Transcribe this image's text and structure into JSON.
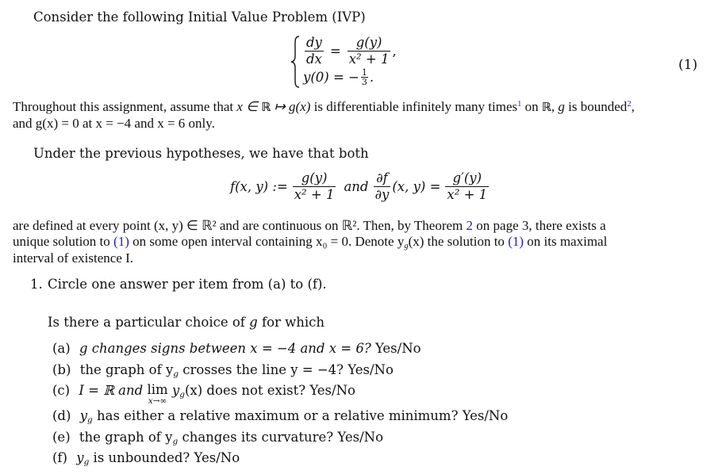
{
  "intro": "Consider the following Initial Value Problem (IVP)",
  "ivp": {
    "lhs_num": "dy",
    "lhs_den": "dx",
    "rhs_num": "g(y)",
    "rhs_den": "x² + 1",
    "trail": ",",
    "initial_lhs": "y(0) = −",
    "initial_frac_num": "1",
    "initial_frac_den": "3",
    "initial_trail": ".",
    "equation_number": "(1)"
  },
  "assumptions": {
    "line1_a": "Throughout this assignment, assume that ",
    "line1_math": "x ∈ ",
    "line1_R": "ℝ",
    "line1_map": " ↦ g(x)",
    "line1_b": " is differentiable infinitely many times",
    "footnote1": "1",
    "line1_c": " on ",
    "line1_R2": "ℝ",
    "line1_d": ", ",
    "line1_g": "g",
    "line1_e": " is bounded",
    "footnote2": "2",
    "line1_f": ",",
    "line2": "and g(x) = 0 at x = −4 and x = 6 only."
  },
  "hypotheses_intro": "Under the previous hypotheses, we have that both",
  "definitions": {
    "f_lhs": "f(x, y) :=",
    "f_num": "g(y)",
    "f_den": "x² + 1",
    "and": "and",
    "partial_num": "∂f",
    "partial_den": "∂y",
    "partial_args": "(x, y) =",
    "deriv_num": "g′(y)",
    "deriv_den": "x² + 1"
  },
  "existence": {
    "line1_a": "are defined at every point (x, y) ∈ ℝ² and are continuous on ℝ². Then, by Theorem ",
    "theorem_ref": "2",
    "line1_b": " on page 3, there exists a",
    "line2_a": "unique solution to ",
    "eq_ref1": "(1)",
    "line2_b": " on some open interval containing x₀ = 0. Denote y",
    "line2_sub": "g",
    "line2_c": "(x) the solution to ",
    "eq_ref2": "(1)",
    "line2_d": " on its maximal",
    "line3": "interval of existence I."
  },
  "question": {
    "number": "1.",
    "instruction": "Circle one answer per item from (a) to (f).",
    "prompt_a": "Is there a particular choice of ",
    "prompt_g": "g",
    "prompt_b": " for which",
    "items": [
      {
        "label": "(a)",
        "text": "g changes signs between x = −4 and x = 6? ",
        "answer": "Yes/No"
      },
      {
        "label": "(b)",
        "text_a": "the graph of y",
        "sub": "g",
        "text_b": " crosses the line y = −4? ",
        "answer": "Yes/No"
      },
      {
        "label": "(c)",
        "text_a": "I = ℝ and ",
        "lim": "lim",
        "lim_under": "x→∞",
        "text_b": " y",
        "sub": "g",
        "text_c": "(x) does not exist? ",
        "answer": "Yes/No"
      },
      {
        "label": "(d)",
        "text_a": "y",
        "sub": "g",
        "text_b": " has either a relative maximum or a relative minimum? ",
        "answer": "Yes/No"
      },
      {
        "label": "(e)",
        "text_a": "the graph of y",
        "sub": "g",
        "text_b": " changes its curvature? ",
        "answer": "Yes/No"
      },
      {
        "label": "(f)",
        "text_a": "y",
        "sub": "g",
        "text_b": " is unbounded? ",
        "answer": "Yes/No"
      }
    ]
  },
  "colors": {
    "text": "#111111",
    "link": "#1a1ad6"
  }
}
